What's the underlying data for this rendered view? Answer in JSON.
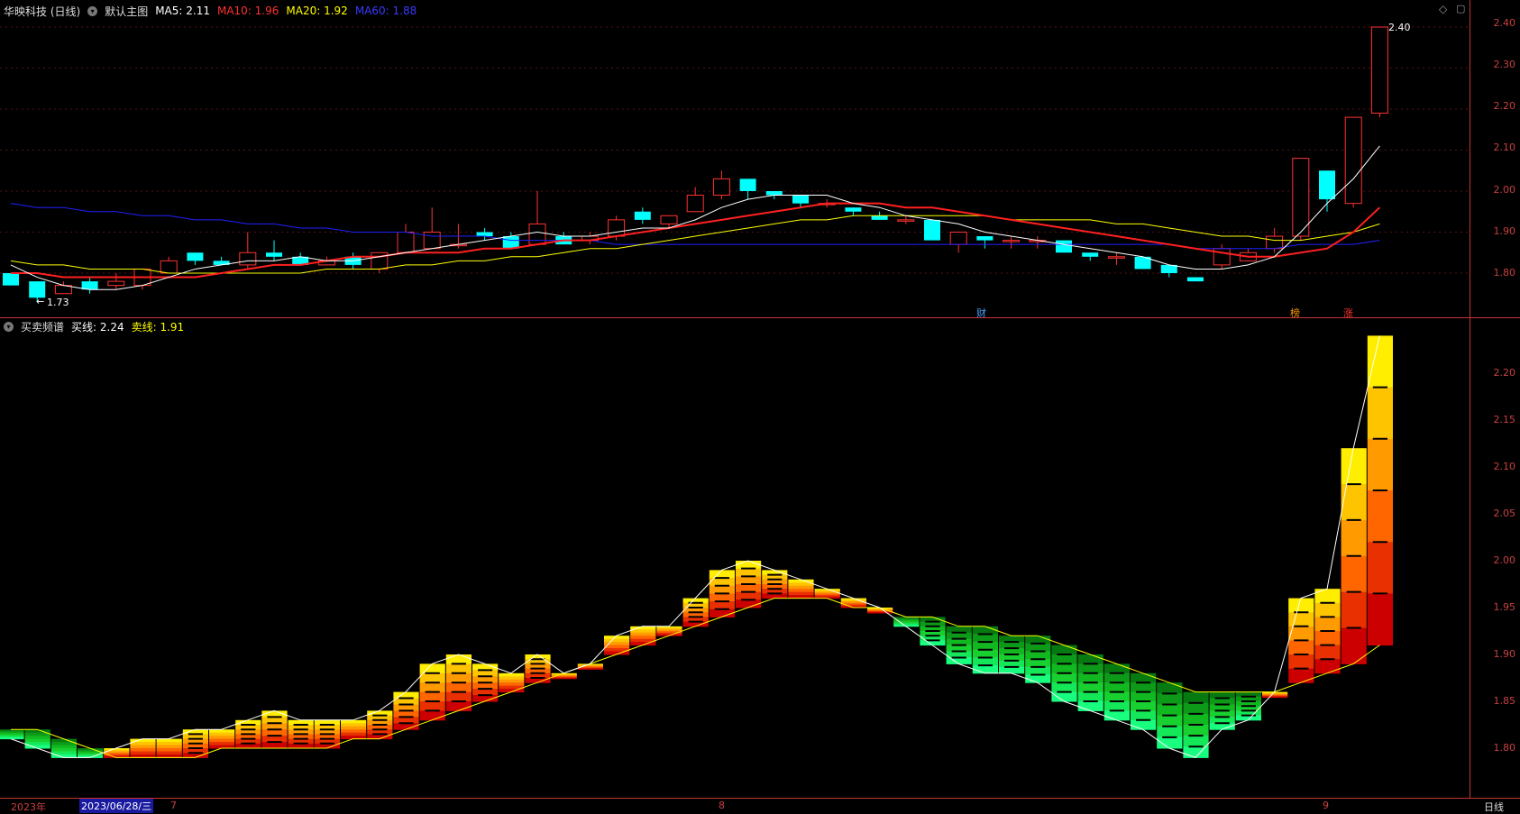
{
  "main_panel": {
    "stock_name": "华映科技 (日线)",
    "indicator_name": "默认主图",
    "ma5": {
      "label": "MA5: 2.11",
      "color": "#ffffff"
    },
    "ma10": {
      "label": "MA10: 1.96",
      "color": "#ff2020"
    },
    "ma20": {
      "label": "MA20: 1.92",
      "color": "#ffff00"
    },
    "ma60": {
      "label": "MA60: 1.88",
      "color": "#2020ff"
    },
    "high_marker": "2.40",
    "low_marker": "1.73",
    "event_tags": [
      {
        "text": "财",
        "color": "#4aa3ff"
      },
      {
        "text": "榜",
        "color": "#ff9900"
      },
      {
        "text": "涨",
        "color": "#ff3030"
      }
    ],
    "yticks": [
      "2.40",
      "2.30",
      "2.20",
      "2.10",
      "2.00",
      "1.90",
      "1.80"
    ]
  },
  "sub_panel": {
    "indicator_name": "买卖频谱",
    "buy_line": {
      "label": "买线: 2.24",
      "color": "#ffffff"
    },
    "sell_line": {
      "label": "卖线: 1.91",
      "color": "#ffff00"
    },
    "yticks": [
      "2.20",
      "2.15",
      "2.10",
      "2.05",
      "2.00",
      "1.95",
      "1.90",
      "1.85",
      "1.80"
    ]
  },
  "bottom_axis": {
    "year_label": "2023年",
    "cursor_date": "2023/06/28/三",
    "month_labels": [
      "7",
      "8",
      "9"
    ],
    "period_button": "日线"
  },
  "colors": {
    "up": "#ff3232",
    "down": "#00ffff",
    "grid": "#5a1010",
    "axis": "#c83232"
  },
  "chart_data": [
    {
      "type": "candlestick",
      "title": "华映科技 (日线)",
      "ylim": [
        1.7,
        2.45
      ],
      "candles": [
        [
          1.8,
          1.77,
          1.8,
          1.77
        ],
        [
          1.78,
          1.74,
          1.78,
          1.73
        ],
        [
          1.75,
          1.77,
          1.78,
          1.75
        ],
        [
          1.78,
          1.76,
          1.79,
          1.75
        ],
        [
          1.77,
          1.78,
          1.8,
          1.76
        ],
        [
          1.77,
          1.81,
          1.81,
          1.76
        ],
        [
          1.8,
          1.83,
          1.84,
          1.8
        ],
        [
          1.85,
          1.83,
          1.85,
          1.82
        ],
        [
          1.83,
          1.82,
          1.84,
          1.82
        ],
        [
          1.82,
          1.85,
          1.9,
          1.81
        ],
        [
          1.85,
          1.84,
          1.88,
          1.83
        ],
        [
          1.84,
          1.82,
          1.85,
          1.82
        ],
        [
          1.82,
          1.83,
          1.84,
          1.82
        ],
        [
          1.84,
          1.82,
          1.85,
          1.81
        ],
        [
          1.81,
          1.85,
          1.85,
          1.8
        ],
        [
          1.85,
          1.9,
          1.92,
          1.85
        ],
        [
          1.86,
          1.9,
          1.96,
          1.86
        ],
        [
          1.87,
          1.87,
          1.92,
          1.86
        ],
        [
          1.9,
          1.89,
          1.91,
          1.88
        ],
        [
          1.89,
          1.86,
          1.9,
          1.86
        ],
        [
          1.87,
          1.92,
          2.0,
          1.87
        ],
        [
          1.89,
          1.87,
          1.9,
          1.87
        ],
        [
          1.88,
          1.89,
          1.9,
          1.87
        ],
        [
          1.89,
          1.93,
          1.94,
          1.88
        ],
        [
          1.95,
          1.93,
          1.96,
          1.92
        ],
        [
          1.92,
          1.94,
          1.94,
          1.91
        ],
        [
          1.95,
          1.99,
          2.01,
          1.95
        ],
        [
          1.99,
          2.03,
          2.05,
          1.98
        ],
        [
          2.03,
          2.0,
          2.03,
          1.98
        ],
        [
          2.0,
          1.99,
          2.0,
          1.98
        ],
        [
          1.99,
          1.97,
          1.99,
          1.96
        ],
        [
          1.97,
          1.97,
          1.98,
          1.96
        ],
        [
          1.96,
          1.95,
          1.96,
          1.94
        ],
        [
          1.94,
          1.93,
          1.95,
          1.93
        ],
        [
          1.93,
          1.93,
          1.94,
          1.92
        ],
        [
          1.93,
          1.88,
          1.93,
          1.88
        ],
        [
          1.87,
          1.9,
          1.9,
          1.85
        ],
        [
          1.89,
          1.88,
          1.89,
          1.86
        ],
        [
          1.88,
          1.88,
          1.89,
          1.86
        ],
        [
          1.88,
          1.88,
          1.89,
          1.86
        ],
        [
          1.88,
          1.85,
          1.88,
          1.85
        ],
        [
          1.85,
          1.84,
          1.85,
          1.83
        ],
        [
          1.84,
          1.84,
          1.85,
          1.82
        ],
        [
          1.84,
          1.81,
          1.84,
          1.81
        ],
        [
          1.82,
          1.8,
          1.82,
          1.79
        ],
        [
          1.79,
          1.78,
          1.79,
          1.78
        ],
        [
          1.82,
          1.86,
          1.87,
          1.81
        ],
        [
          1.83,
          1.85,
          1.86,
          1.83
        ],
        [
          1.86,
          1.89,
          1.91,
          1.85
        ],
        [
          1.89,
          2.08,
          2.08,
          1.88
        ],
        [
          2.05,
          1.98,
          2.05,
          1.95
        ],
        [
          1.97,
          2.18,
          2.18,
          1.96
        ],
        [
          2.19,
          2.4,
          2.4,
          2.18
        ]
      ],
      "ma5": [
        1.82,
        1.79,
        1.77,
        1.76,
        1.76,
        1.77,
        1.79,
        1.81,
        1.82,
        1.83,
        1.83,
        1.84,
        1.83,
        1.83,
        1.84,
        1.85,
        1.86,
        1.87,
        1.88,
        1.89,
        1.9,
        1.89,
        1.89,
        1.9,
        1.91,
        1.91,
        1.93,
        1.96,
        1.98,
        1.99,
        1.99,
        1.99,
        1.97,
        1.96,
        1.94,
        1.93,
        1.92,
        1.9,
        1.89,
        1.88,
        1.87,
        1.86,
        1.85,
        1.84,
        1.82,
        1.81,
        1.81,
        1.82,
        1.84,
        1.9,
        1.97,
        2.03,
        2.11
      ],
      "ma10": [
        1.8,
        1.8,
        1.79,
        1.79,
        1.79,
        1.79,
        1.79,
        1.79,
        1.8,
        1.81,
        1.82,
        1.82,
        1.83,
        1.84,
        1.84,
        1.85,
        1.85,
        1.85,
        1.86,
        1.86,
        1.87,
        1.88,
        1.88,
        1.89,
        1.9,
        1.91,
        1.92,
        1.93,
        1.94,
        1.95,
        1.96,
        1.97,
        1.97,
        1.97,
        1.96,
        1.96,
        1.95,
        1.94,
        1.93,
        1.92,
        1.91,
        1.9,
        1.89,
        1.88,
        1.87,
        1.86,
        1.85,
        1.84,
        1.84,
        1.85,
        1.86,
        1.9,
        1.96
      ],
      "ma20": [
        1.83,
        1.82,
        1.82,
        1.81,
        1.81,
        1.81,
        1.8,
        1.8,
        1.8,
        1.8,
        1.8,
        1.8,
        1.81,
        1.81,
        1.81,
        1.82,
        1.82,
        1.83,
        1.83,
        1.84,
        1.84,
        1.85,
        1.86,
        1.86,
        1.87,
        1.88,
        1.89,
        1.9,
        1.91,
        1.92,
        1.93,
        1.93,
        1.94,
        1.94,
        1.94,
        1.94,
        1.94,
        1.94,
        1.93,
        1.93,
        1.93,
        1.93,
        1.92,
        1.92,
        1.91,
        1.9,
        1.89,
        1.89,
        1.88,
        1.88,
        1.89,
        1.9,
        1.92
      ],
      "ma60": [
        1.97,
        1.96,
        1.96,
        1.95,
        1.95,
        1.94,
        1.94,
        1.93,
        1.93,
        1.92,
        1.92,
        1.91,
        1.91,
        1.9,
        1.9,
        1.9,
        1.89,
        1.89,
        1.89,
        1.88,
        1.88,
        1.88,
        1.88,
        1.87,
        1.87,
        1.87,
        1.87,
        1.87,
        1.87,
        1.87,
        1.87,
        1.87,
        1.87,
        1.87,
        1.87,
        1.87,
        1.87,
        1.87,
        1.87,
        1.87,
        1.87,
        1.87,
        1.87,
        1.87,
        1.87,
        1.86,
        1.86,
        1.86,
        1.86,
        1.87,
        1.87,
        1.87,
        1.88
      ]
    },
    {
      "type": "heatmap",
      "title": "买卖频谱",
      "ylim": [
        1.775,
        2.245
      ],
      "buy_line": [
        1.81,
        1.8,
        1.79,
        1.79,
        1.8,
        1.81,
        1.81,
        1.82,
        1.82,
        1.83,
        1.84,
        1.83,
        1.83,
        1.83,
        1.84,
        1.86,
        1.89,
        1.9,
        1.89,
        1.88,
        1.9,
        1.88,
        1.89,
        1.92,
        1.93,
        1.93,
        1.96,
        1.99,
        2.0,
        1.99,
        1.98,
        1.97,
        1.96,
        1.95,
        1.93,
        1.91,
        1.89,
        1.88,
        1.88,
        1.87,
        1.85,
        1.84,
        1.83,
        1.82,
        1.8,
        1.79,
        1.82,
        1.83,
        1.86,
        1.96,
        1.97,
        2.12,
        2.24
      ],
      "sell_line": [
        1.82,
        1.82,
        1.81,
        1.8,
        1.79,
        1.79,
        1.79,
        1.79,
        1.8,
        1.8,
        1.8,
        1.8,
        1.8,
        1.81,
        1.81,
        1.82,
        1.83,
        1.84,
        1.85,
        1.86,
        1.87,
        1.88,
        1.89,
        1.9,
        1.91,
        1.92,
        1.93,
        1.94,
        1.95,
        1.96,
        1.96,
        1.96,
        1.95,
        1.95,
        1.94,
        1.94,
        1.93,
        1.93,
        1.92,
        1.92,
        1.91,
        1.9,
        1.89,
        1.88,
        1.87,
        1.86,
        1.86,
        1.86,
        1.86,
        1.87,
        1.88,
        1.89,
        1.91
      ]
    }
  ]
}
